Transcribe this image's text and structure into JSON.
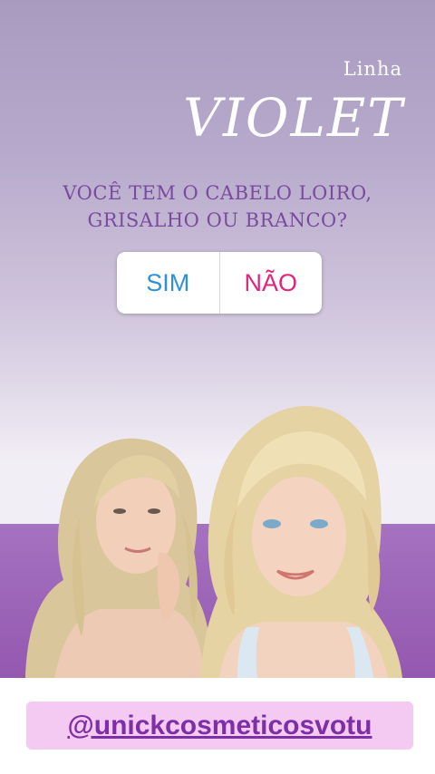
{
  "brand": {
    "line_label": "Linha",
    "name": "VIOLET"
  },
  "question": {
    "line1": "VOCÊ TEM O CABELO LOIRO,",
    "line2": "GRISALHO OU BRANCO?"
  },
  "poll": {
    "option_yes": "SIM",
    "option_no": "NÃO",
    "yes_color": "#2f8fd8",
    "no_color": "#e0247a"
  },
  "photo": {
    "description_icon": "two-blonde-women-photo"
  },
  "footer": {
    "mention": "@unickcosmeticosvotu",
    "mention_color": "#7d2fa6",
    "background": "#f4c9f2"
  },
  "colors": {
    "accent_purple": "#9458b0",
    "question_text": "#7a4a9e"
  }
}
